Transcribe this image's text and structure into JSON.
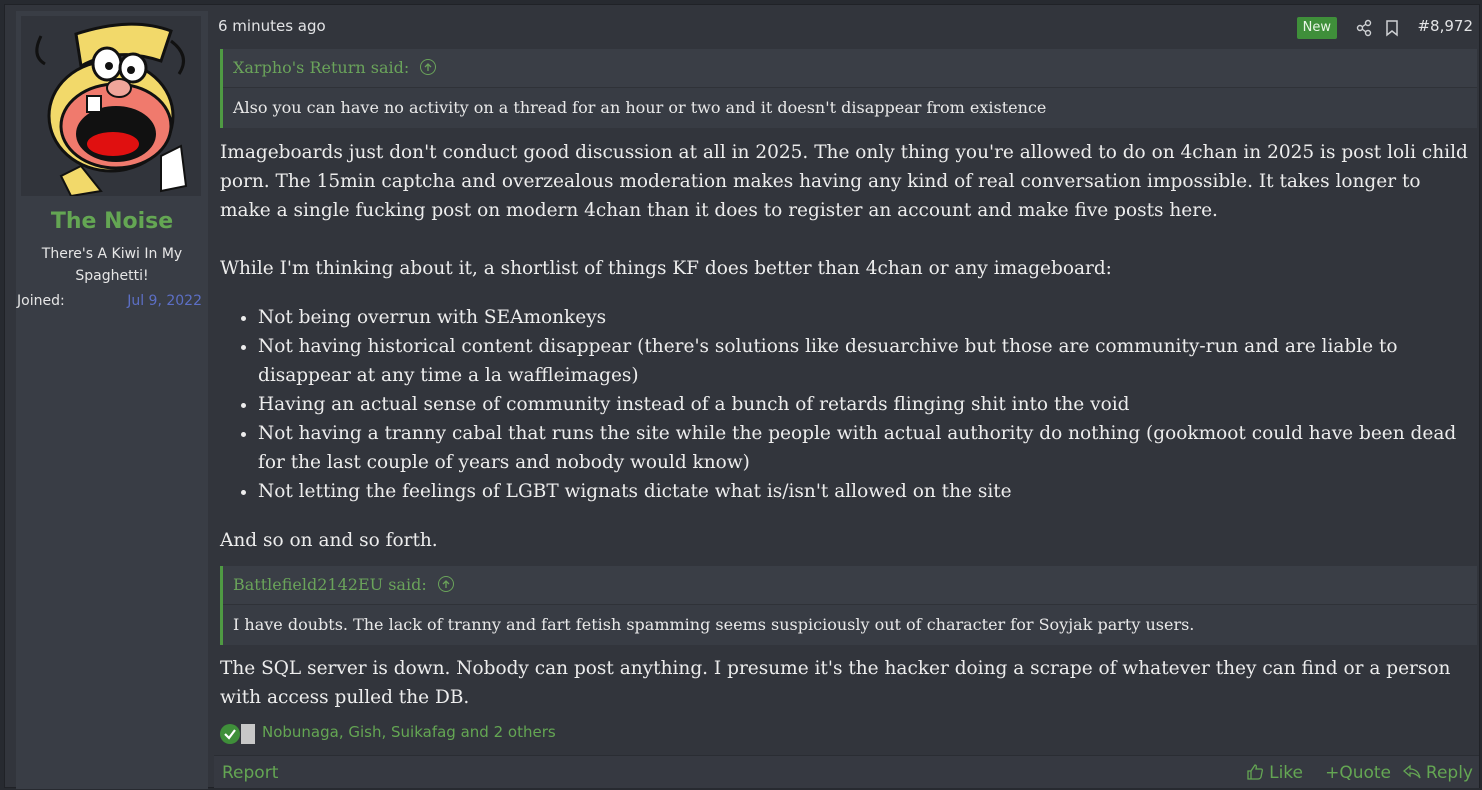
{
  "author": {
    "username": "The Noise",
    "title": "There's A Kiwi In My Spaghetti!",
    "joined_label": "Joined:",
    "joined_value": "Jul 9, 2022"
  },
  "header": {
    "time": "6 minutes ago",
    "badge": "New",
    "post_number": "#8,972"
  },
  "quote1": {
    "author": "Xarpho's Return said:",
    "text": "Also you can have no activity on a thread for an hour or two and it doesn't disappear from existence"
  },
  "paragraph1": "Imageboards just don't conduct good discussion at all in 2025. The only thing you're allowed to do on 4chan in 2025 is post loli child porn. The 15min captcha and overzealous moderation makes having any kind of real conversation impossible. It takes longer to make a single fucking post on modern 4chan than it does to register an account and make five posts here.",
  "paragraph2": "While I'm thinking about it, a shortlist of things KF does better than 4chan or any imageboard:",
  "list": [
    "Not being overrun with SEAmonkeys",
    "Not having historical content disappear (there's solutions like desuarchive but those are community-run and are liable to disappear at any time a la waffleimages)",
    "Having an actual sense of community instead of a bunch of retards flinging shit into the void",
    "Not having a tranny cabal that runs the site while the people with actual authority do nothing (gookmoot could have been dead for the last couple of years and nobody would know)",
    "Not letting the feelings of LGBT wignats dictate what is/isn't allowed on the site"
  ],
  "paragraph3": "And so on and so forth.",
  "quote2": {
    "author": "Battlefield2142EU said:",
    "text": "I have doubts. The lack of tranny and fart fetish spamming seems suspiciously out of character for Soyjak party users."
  },
  "paragraph4": "The SQL server is down. Nobody can post anything. I presume it's the hacker doing a scrape of whatever they can find or a person with access pulled the DB.",
  "reactions": "Nobunaga, Gish, Suikafag and 2 others",
  "footer": {
    "report": "Report",
    "like": "Like",
    "quote": "Quote",
    "reply": "Reply"
  },
  "colors": {
    "accent": "#64a653",
    "background": "#32353c",
    "sidebar": "#393d45"
  }
}
